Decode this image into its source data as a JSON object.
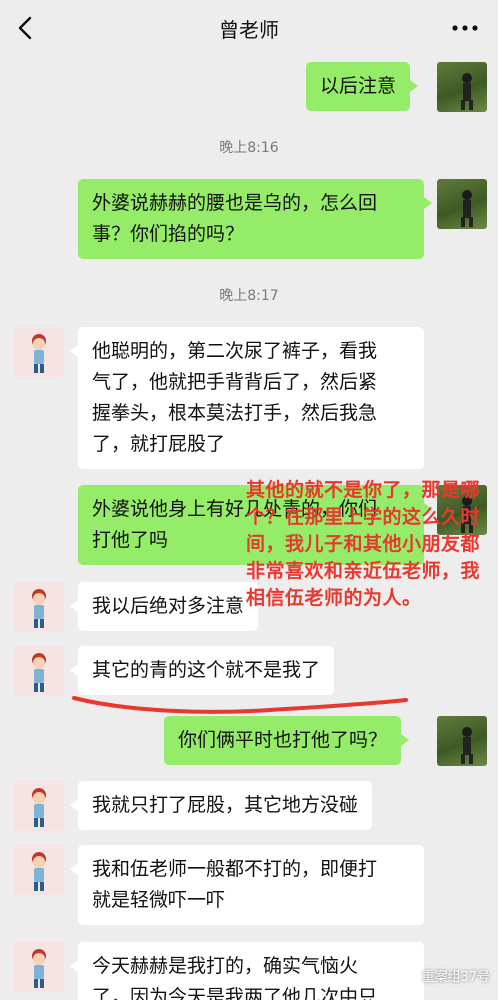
{
  "header": {
    "title": "曾老师"
  },
  "times": [
    "晚上8:16",
    "晚上8:17"
  ],
  "messages": [
    {
      "side": "out",
      "text": "以后注意"
    },
    {
      "side": "out",
      "text": "外婆说赫赫的腰也是乌的，怎么回\n事？你们掐的吗？"
    },
    {
      "side": "in",
      "text": "他聪明的，第二次尿了裤子，看我\n气了，他就把手背背后了，然后紧\n握拳头，根本莫法打手，然后我急\n了，就打屁股了"
    },
    {
      "side": "out",
      "text": "外婆说他身上有好几处青的，你们\n打他了吗"
    },
    {
      "side": "in",
      "text": "我以后绝对多注意"
    },
    {
      "side": "in",
      "text": "其它的青的这个就不是我了"
    },
    {
      "side": "out",
      "text": "你们俩平时也打他了吗？"
    },
    {
      "side": "in",
      "text": "我就只打了屁股，其它地方没碰"
    },
    {
      "side": "in",
      "text": "我和伍老师一般都不打的，即便打\n就是轻微吓一吓"
    },
    {
      "side": "in",
      "text": "今天赫赫是我打的，确实气恼火\n了，因为今天是我两了他几次中只"
    }
  ],
  "annotation": {
    "text": "其他的就不是你了，那是哪个？在那里上学的这么久时间，我儿子和其他小朋友都非常喜欢和亲近伍老师，我相信伍老师的为人。",
    "color": "#e8392e"
  },
  "watermark": {
    "text": "重案组37号"
  },
  "colors": {
    "background": "#ededed",
    "bubble_out": "#95ec69",
    "bubble_in": "#ffffff",
    "annotation": "#e8392e"
  },
  "icons": {
    "back": "chevron-left-icon",
    "more": "more-dots-icon"
  }
}
